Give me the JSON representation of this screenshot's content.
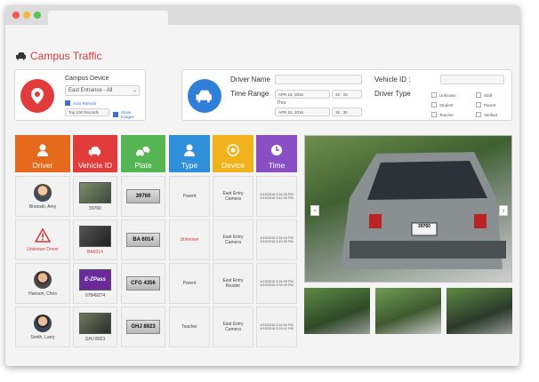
{
  "app": {
    "title": "Campus Traffic"
  },
  "device": {
    "label": "Campus Device",
    "selected": "East Entrance - All",
    "auto_refresh": "Auto Refresh",
    "records": "Top 100 Records",
    "show_images": "Show Images"
  },
  "filters": {
    "driver_name": "Driver Name",
    "time_range": "Time Range",
    "vehicle_id": "Vehicle ID :",
    "driver_type": "Driver Type",
    "date1": "APR 15, 2016",
    "time1": "15 : 15",
    "thru": "Thru",
    "date2": "APR 15, 2016",
    "time2": "15 : 30",
    "types": [
      "Unknown",
      "Staff",
      "Student",
      "Parent",
      "Teacher",
      "Verified"
    ]
  },
  "columns": [
    {
      "label": "Driver",
      "color": "#e56a1b",
      "icon": "person-icon"
    },
    {
      "label": "Vehicle ID",
      "color": "#e23b3b",
      "icon": "car-icon"
    },
    {
      "label": "Plate",
      "color": "#55b552",
      "icon": "cars-icon"
    },
    {
      "label": "Type",
      "color": "#2f8fd8",
      "icon": "person-icon"
    },
    {
      "label": "Device",
      "color": "#f2b21c",
      "icon": "camera-icon"
    },
    {
      "label": "Time",
      "color": "#8a4fc4",
      "icon": "clock-icon"
    }
  ],
  "rows": [
    {
      "driver": "Brianski, Amy",
      "vehicle": "39760",
      "plate": "39760",
      "type": "Parent",
      "device": "East Entry Camera",
      "time1": "4/15/2016 3:34:26 PM",
      "time2": "4/15/2016 3:40:30 PM"
    },
    {
      "driver": "Unknown Driver",
      "vehicle": "BA6014",
      "plate": "BA 6014",
      "type": "Unknown",
      "device": "East Entry Camera",
      "time1": "4/15/2016 3:34:16 PM",
      "time2": "4/15/2016 3:40:33 PM"
    },
    {
      "driver": "Hanson, Chris",
      "vehicle": "07849274",
      "plate": "CFG 4356",
      "type": "Parent",
      "device": "East Entry Reader",
      "time1": "4/15/2016 3:34:09 PM",
      "time2": "4/15/2016 3:39:49 PM"
    },
    {
      "driver": "Smith, Larry",
      "vehicle": "GHJ 8923",
      "plate": "GHJ 8923",
      "type": "Teacher",
      "device": "East Entry Camera",
      "time1": "4/15/2016 3:34:00 PM",
      "time2": "4/15/2016 3:29:41 PM"
    }
  ],
  "viewer": {
    "plate_text": "39760",
    "prev": "‹",
    "next": "›",
    "ezpass": "E-ZPass"
  }
}
